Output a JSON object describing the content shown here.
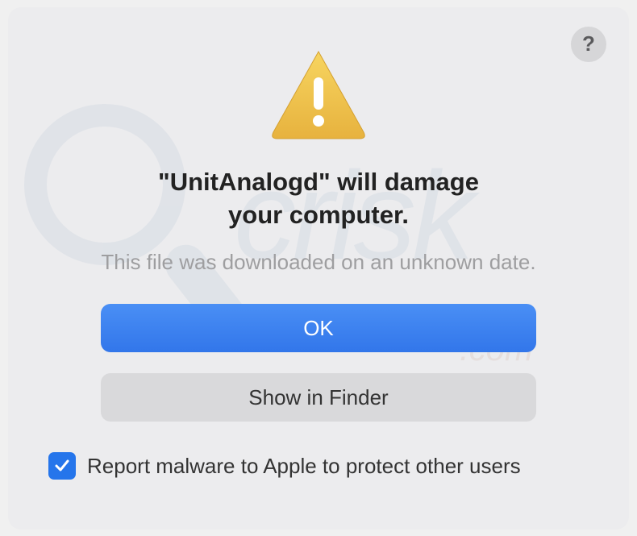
{
  "dialog": {
    "title_line1": "\"UnitAnalogd\" will damage",
    "title_line2": "your computer.",
    "subtitle": "This file was downloaded on an unknown date.",
    "primary_button": "OK",
    "secondary_button": "Show in Finder",
    "checkbox_label": "Report malware to Apple to protect other users",
    "checkbox_checked": true,
    "help_label": "?"
  },
  "watermark": {
    "text": "crisk",
    "suffix": ".com"
  }
}
